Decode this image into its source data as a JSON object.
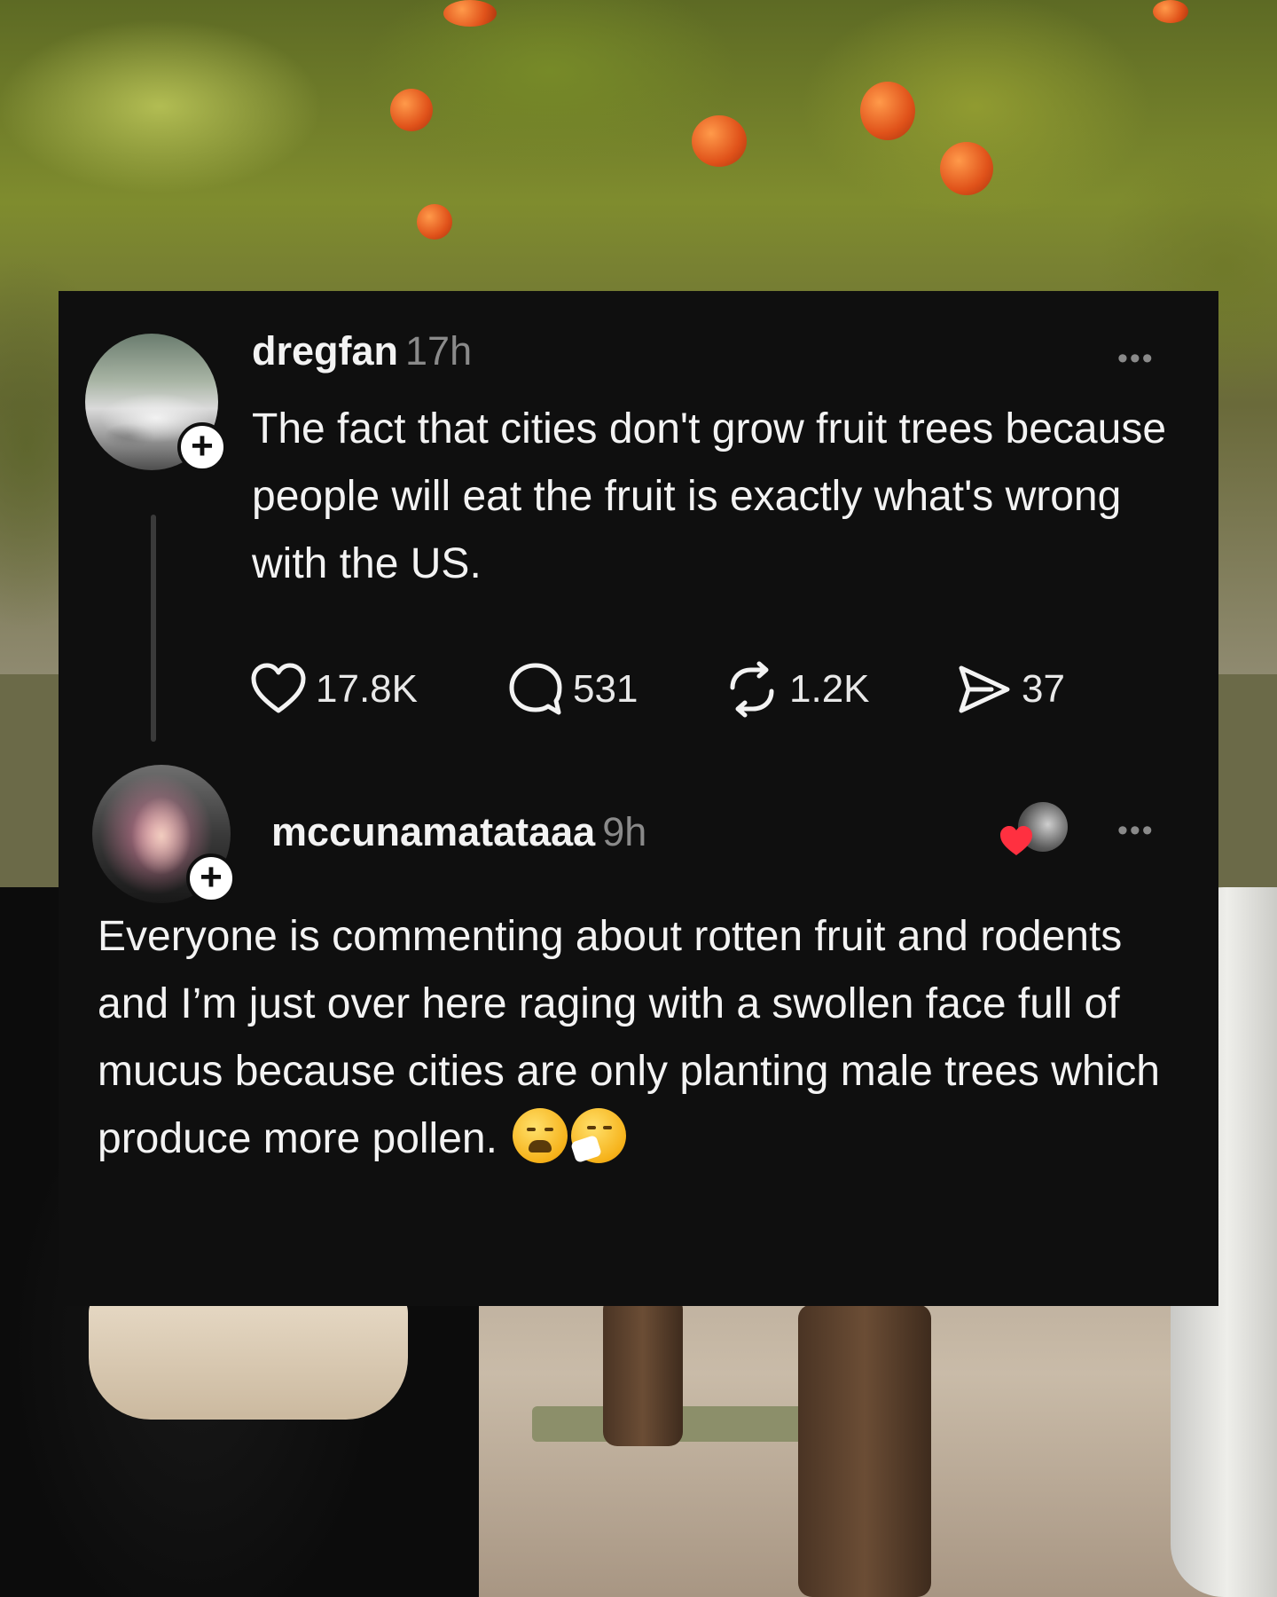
{
  "post": {
    "username": "dregfan",
    "time": "17h",
    "text": "The fact that cities don't grow fruit trees because people will eat the fruit is exactly what's wrong with the US.",
    "actions": {
      "likes": "17.8K",
      "comments": "531",
      "reposts": "1.2K",
      "shares": "37"
    },
    "follow_symbol": "+",
    "more_symbol": "•••"
  },
  "reply": {
    "username": "mccunamatataaa",
    "time": "9h",
    "text": "Everyone is commenting about rotten fruit and rodents and I’m just over here raging with a swollen face full of mucus because cities are only planting male trees which produce more pollen.",
    "emojis": [
      "😩",
      "🤧"
    ],
    "follow_symbol": "+",
    "more_symbol": "•••"
  },
  "icons": {
    "like": "heart-icon",
    "comment": "comment-bubble-icon",
    "repost": "repost-icon",
    "share": "send-icon",
    "liked_by": "heart-icon"
  },
  "colors": {
    "card_background": "#0f0f0f",
    "text_primary": "#f3f3f3",
    "text_secondary": "#8a8a8a",
    "heart_red": "#ff3040"
  }
}
